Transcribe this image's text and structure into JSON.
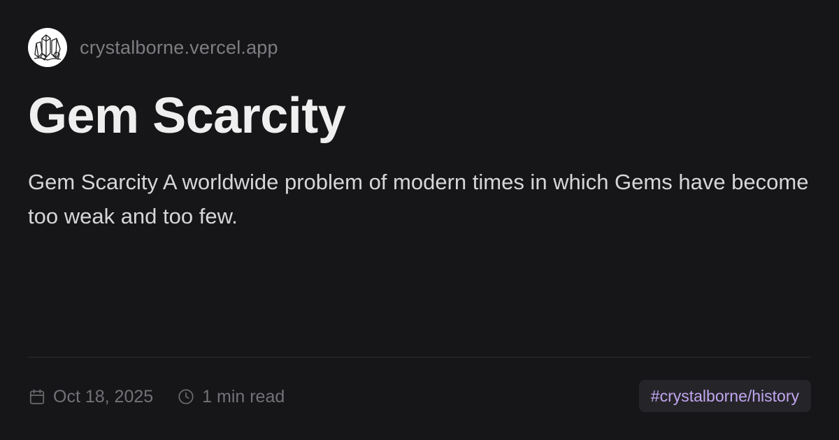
{
  "site": {
    "name": "crystalborne.vercel.app",
    "logo_icon": "crystal-cluster-icon"
  },
  "post": {
    "title": "Gem Scarcity",
    "description": "Gem Scarcity A worldwide problem of modern times in which Gems have become too weak and too few."
  },
  "meta": {
    "date": "Oct 18, 2025",
    "date_icon": "calendar-icon",
    "read_time": "1 min read",
    "read_time_icon": "clock-icon"
  },
  "tag": {
    "label": "#crystalborne/history"
  },
  "colors": {
    "background": "#161618",
    "title": "#efefef",
    "muted": "#727278",
    "tag_text": "#c2a6f0",
    "tag_background": "#252529"
  }
}
